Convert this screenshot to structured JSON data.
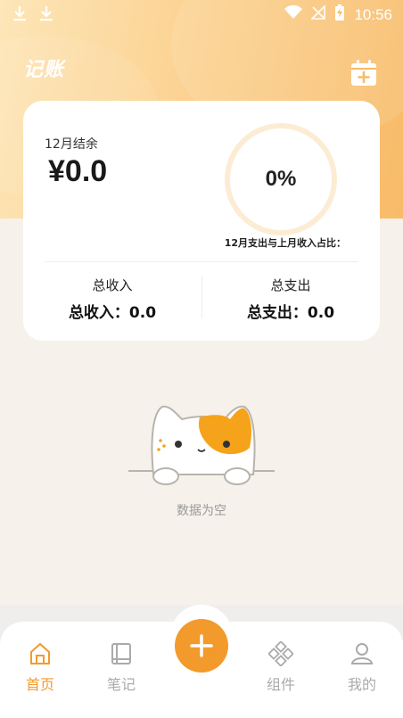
{
  "status_bar": {
    "time": "10:56"
  },
  "header": {
    "title": "记账"
  },
  "balance_card": {
    "month_balance_label": "12月结余",
    "balance_value": "¥0.0",
    "ratio_percent": "0%",
    "ratio_label": "12月支出与上月收入占比：",
    "income_title": "总收入",
    "income_value": "总收入：0.0",
    "expense_title": "总支出",
    "expense_value": "总支出：0.0"
  },
  "empty_state": {
    "text": "数据为空"
  },
  "bottom_nav": {
    "items": [
      {
        "label": "首页",
        "icon": "home-icon",
        "active": true
      },
      {
        "label": "笔记",
        "icon": "book-icon",
        "active": false
      },
      {
        "label": "组件",
        "icon": "components-icon",
        "active": false
      },
      {
        "label": "我的",
        "icon": "user-icon",
        "active": false
      }
    ],
    "fab_icon": "plus-icon"
  },
  "colors": {
    "accent": "#f39a2c",
    "header_start": "#fde6b8",
    "header_end": "#f8bb68",
    "background": "#f6f1eb"
  }
}
